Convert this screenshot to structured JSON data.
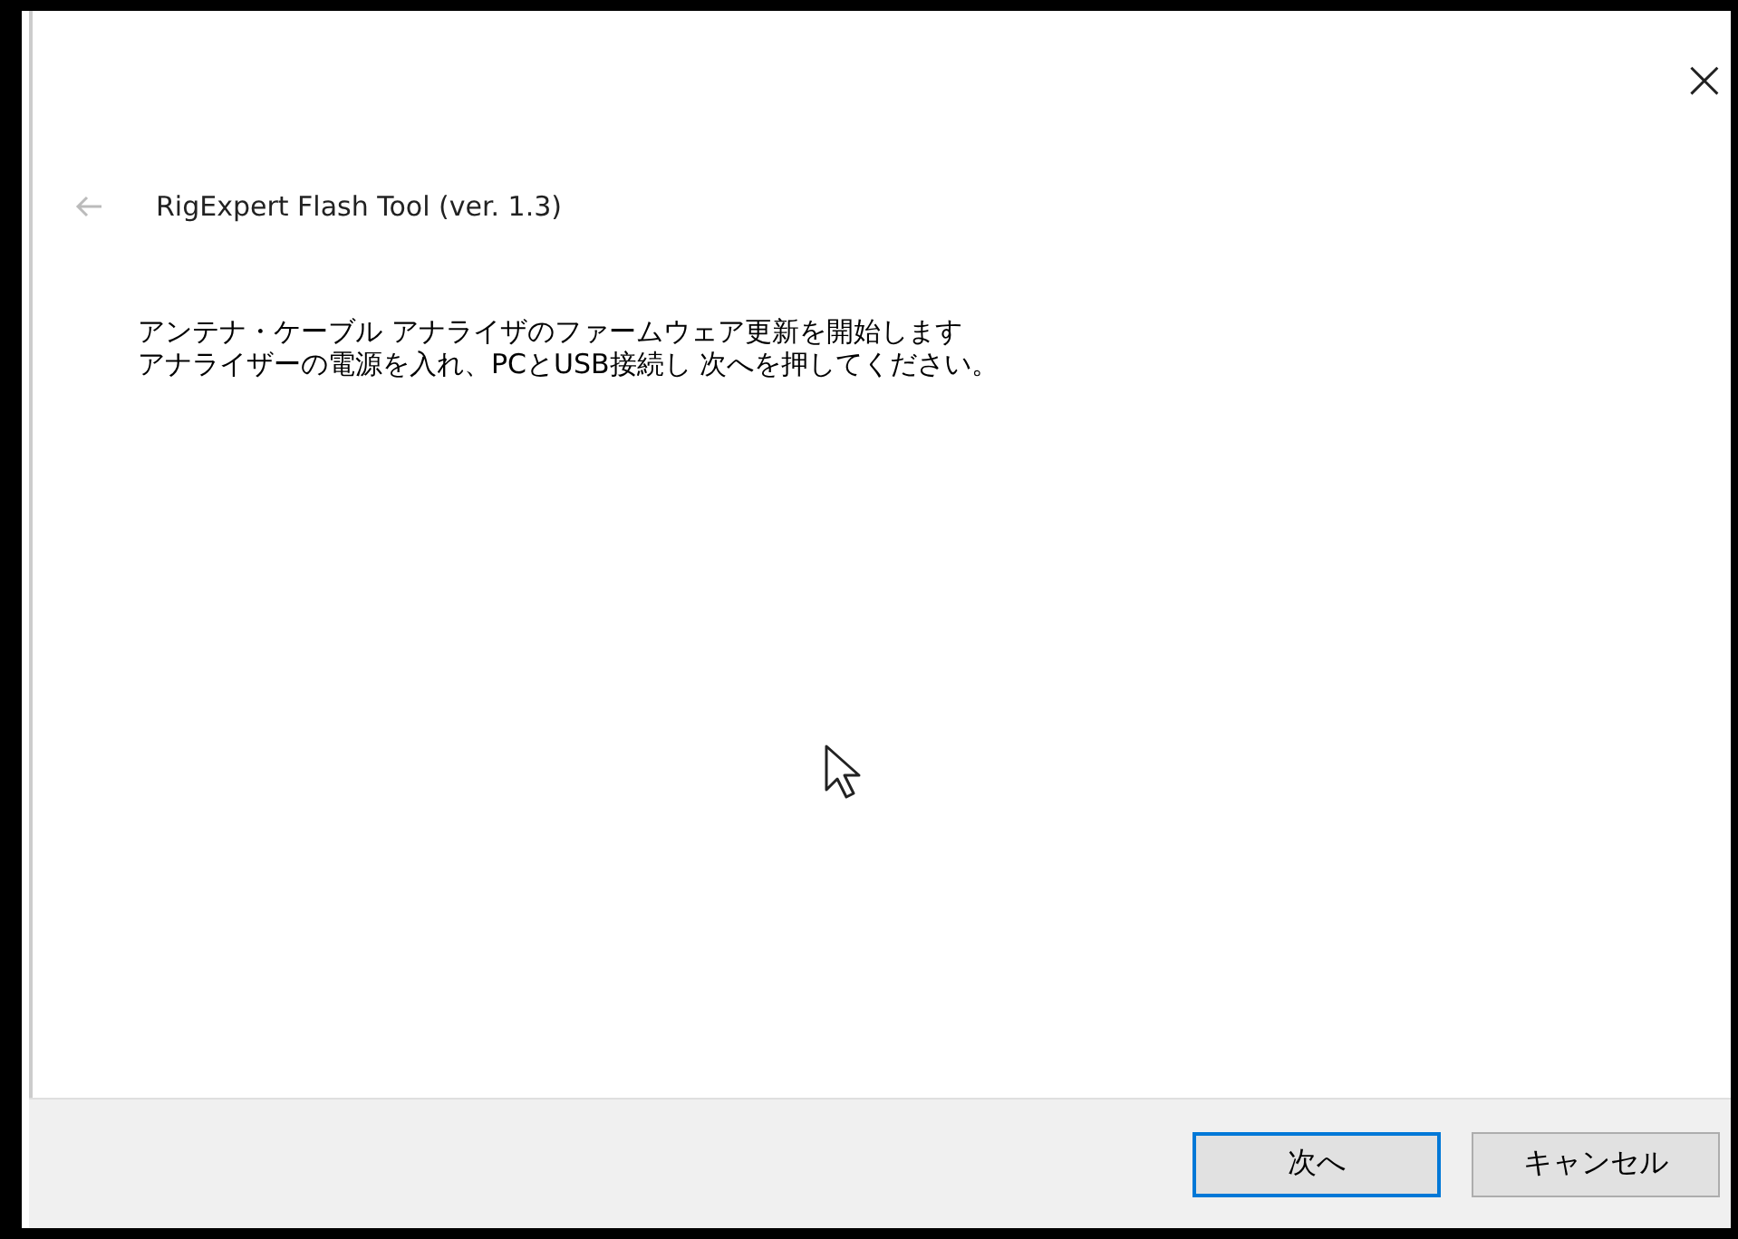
{
  "window": {
    "title": "RigExpert Flash Tool (ver. 1.3)",
    "close": "×"
  },
  "back_button": {
    "disabled": true
  },
  "message_lines": [
    "アンテナ・ケーブル アナライザのファームウェア更新を開始します",
    "アナライザーの電源を入れ、PCとUSB接続し 次へを押してください。"
  ],
  "buttons": [
    {
      "label": "次へ",
      "focused": true
    },
    {
      "label": "キャンセル",
      "focused": false
    }
  ]
}
